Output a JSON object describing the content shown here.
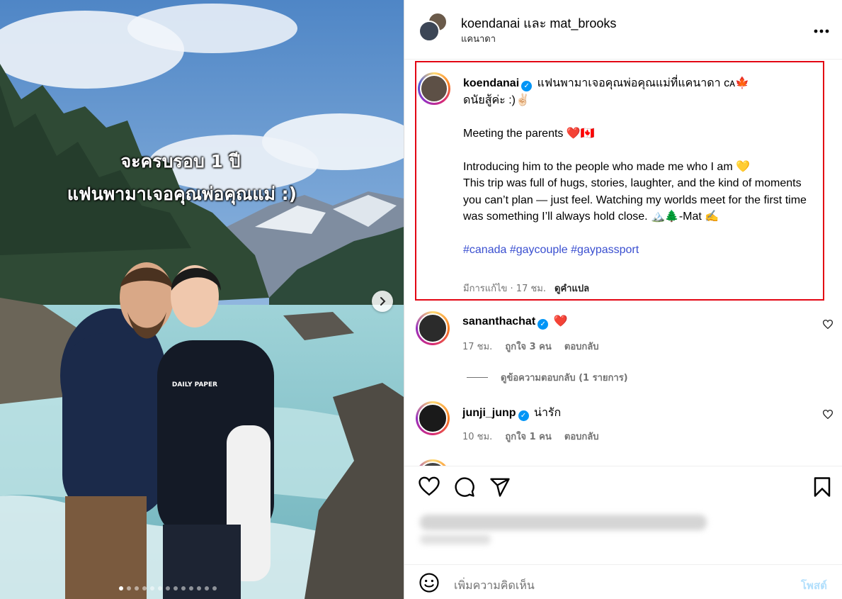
{
  "photo": {
    "overlay_line1": "จะครบรอบ 1 ปี",
    "overlay_line2": "แฟนพามาเจอคุณพ่อคุณแม่ :)",
    "carousel_total": 13,
    "carousel_active_index": 0
  },
  "header": {
    "title": "koendanai และ mat_brooks",
    "location": "แคนาดา",
    "more_icon": "more-horizontal-icon"
  },
  "caption": {
    "username": "koendanai",
    "line1": " แฟนพามาเจอคุณพ่อคุณแม่ที่แคนาดา ᴄᴀ🍁",
    "line2": "ดนัยสู้ค่ะ :)✌🏻",
    "para1": "Meeting the parents ❤️🇨🇦",
    "para2": "Introducing him to the people who made me who I am 💛",
    "para3": "This trip was full of hugs, stories, laughter, and the kind of moments you can’t plan — just feel. Watching my worlds meet for the first time was something I’ll always hold close. 🏔️🌲-Mat ✍️",
    "hashtags": [
      "#canada",
      "#gaycouple",
      "#gaypassport"
    ],
    "meta_time": "มีการแก้ไข · 17 ชม.",
    "translate": "ดูคำแปล"
  },
  "comments": [
    {
      "username": "sananthachat",
      "text": "❤️",
      "time": "17 ชม.",
      "likes": "ถูกใจ 3 คน",
      "reply": "ตอบกลับ",
      "view_replies": "ดูข้อความตอบกลับ (1 รายการ)"
    },
    {
      "username": "junji_junp",
      "text": "น่ารัก",
      "time": "10 ชม.",
      "likes": "ถูกใจ 1 คน",
      "reply": "ตอบกลับ"
    }
  ],
  "comment_box": {
    "placeholder": "เพิ่มความคิดเห็น",
    "post_label": "โพสต์"
  },
  "colors": {
    "highlight_border": "#e30613",
    "verified": "#0095f6",
    "hashtag": "#3a4fd0",
    "post_disabled": "#b2dffc"
  }
}
